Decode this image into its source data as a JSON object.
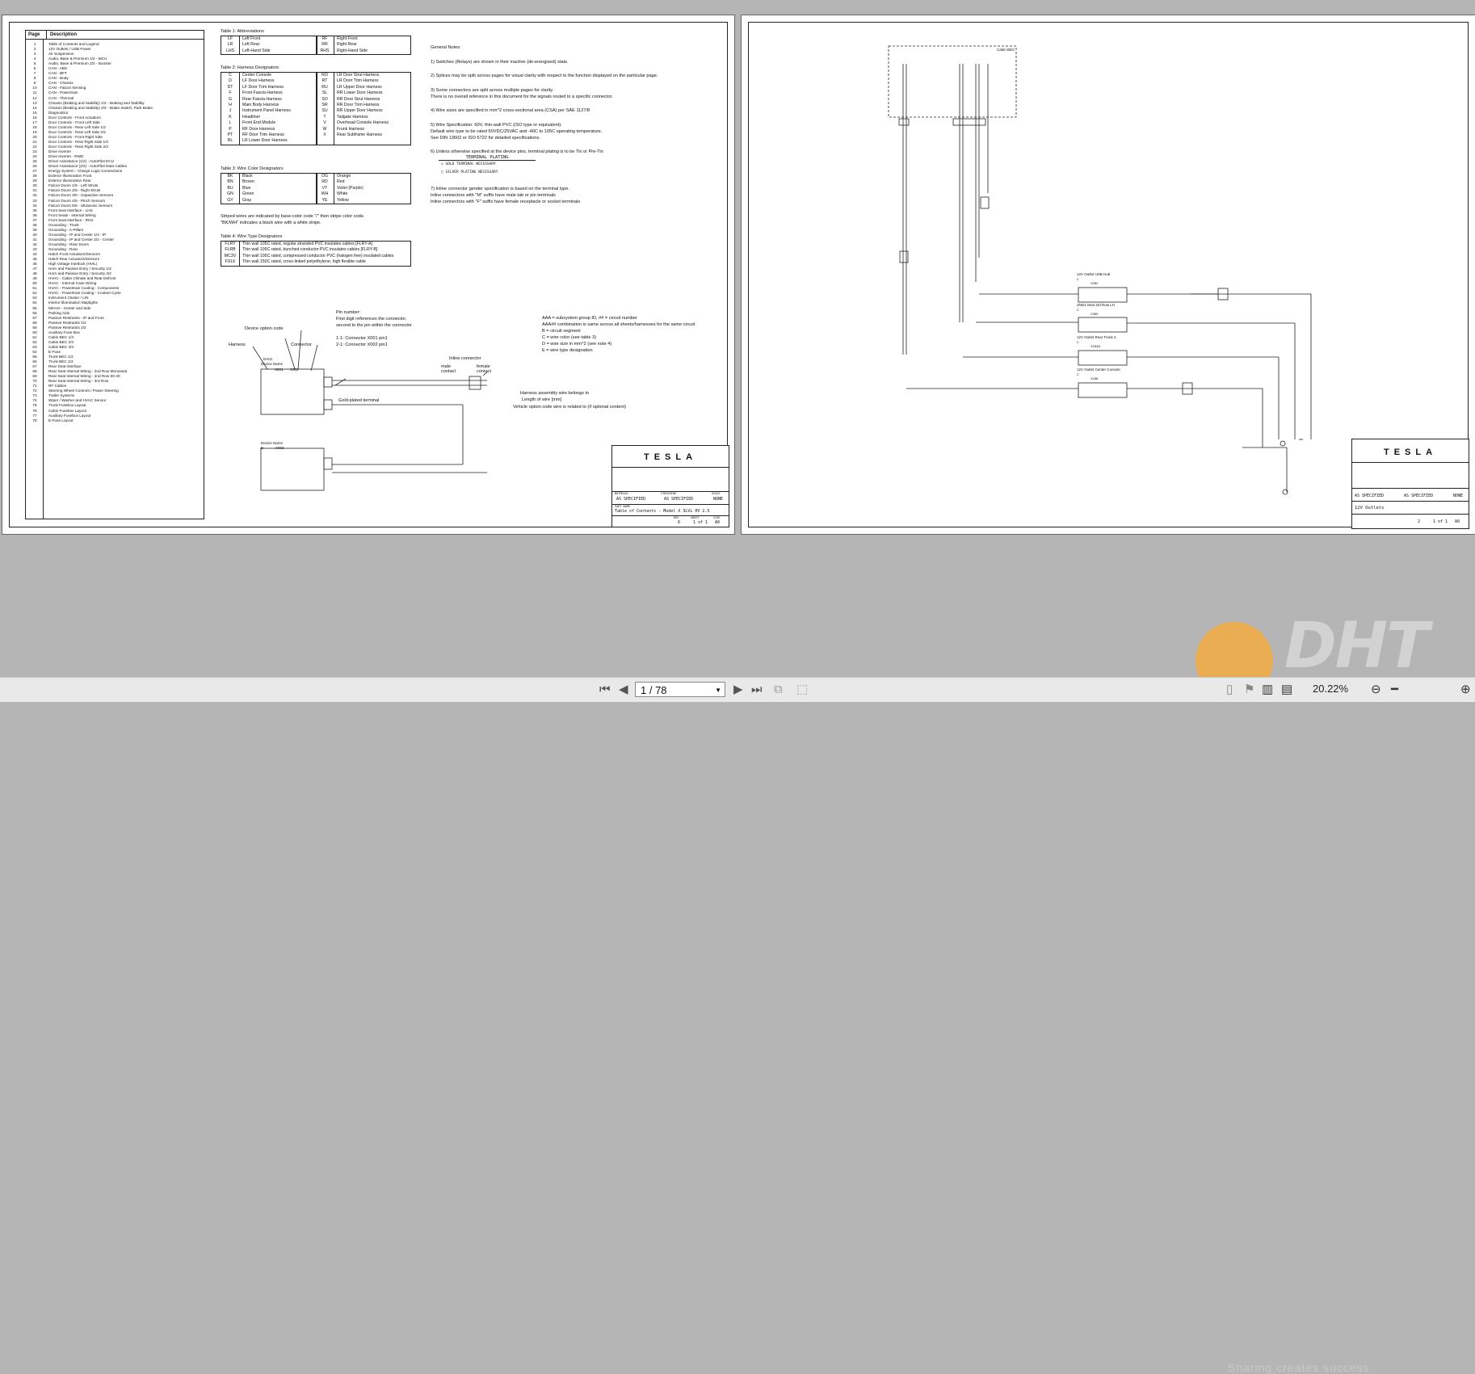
{
  "sheet1": {
    "toc_header": {
      "page": "Page",
      "description": "Description"
    },
    "toc": [
      {
        "p": "1",
        "d": "Table of Contents and Legend"
      },
      {
        "p": "2",
        "d": "12V Outlets / USB Power"
      },
      {
        "p": "3",
        "d": "Air Suspension"
      },
      {
        "p": "4",
        "d": "Audio, Base & Premium 1/2 - MCU"
      },
      {
        "p": "5",
        "d": "Audio, Base & Premium 2/2 - Booster"
      },
      {
        "p": "6",
        "d": "CAN - ABS"
      },
      {
        "p": "7",
        "d": "CAN - BFT"
      },
      {
        "p": "8",
        "d": "CAN - Body"
      },
      {
        "p": "9",
        "d": "CAN - Chassis"
      },
      {
        "p": "10",
        "d": "CAN - Falcon Sensing"
      },
      {
        "p": "11",
        "d": "CAN - Powertrain"
      },
      {
        "p": "12",
        "d": "CAN - Thermal"
      },
      {
        "p": "13",
        "d": "Chassis (Braking and Stability) 1/2 - Braking and Stability"
      },
      {
        "p": "14",
        "d": "Chassis (Braking and Stability) 2/2 - Brake Switch, Park Brake"
      },
      {
        "p": "15",
        "d": "Diagnostics"
      },
      {
        "p": "16",
        "d": "Door Controls - Front Actuators"
      },
      {
        "p": "17",
        "d": "Door Controls - Front Left Side"
      },
      {
        "p": "18",
        "d": "Door Controls - Rear Left Side 1/2"
      },
      {
        "p": "19",
        "d": "Door Controls - Rear Left Side 2/2"
      },
      {
        "p": "20",
        "d": "Door Controls - Front Right Side"
      },
      {
        "p": "21",
        "d": "Door Controls - Rear Right Side 1/2"
      },
      {
        "p": "22",
        "d": "Door Controls - Rear Right Side 2/2"
      },
      {
        "p": "23",
        "d": "Drive Inverter"
      },
      {
        "p": "24",
        "d": "Drive Inverter - RWD"
      },
      {
        "p": "25",
        "d": "Driver Assistance (1/2) - AutoPilot ECU"
      },
      {
        "p": "26",
        "d": "Driver Assistance (2/2) - AutoPilot Data Cables"
      },
      {
        "p": "27",
        "d": "Energy System - Charge Logic Connections"
      },
      {
        "p": "28",
        "d": "Exterior Illumination Front"
      },
      {
        "p": "29",
        "d": "Exterior Illumination Rear"
      },
      {
        "p": "30",
        "d": "Falcon Doors 1/5 - Left Struts"
      },
      {
        "p": "31",
        "d": "Falcon Doors 2/5 - Right Struts"
      },
      {
        "p": "32",
        "d": "Falcon Doors 3/5 - Capacitive Sensors"
      },
      {
        "p": "33",
        "d": "Falcon Doors 4/5 - Pinch Sensors"
      },
      {
        "p": "34",
        "d": "Falcon Doors 5/5 - Ultrasonic Sensors"
      },
      {
        "p": "35",
        "d": "Front Seat Interface - LHS"
      },
      {
        "p": "36",
        "d": "Front Seats - Internal Wiring"
      },
      {
        "p": "37",
        "d": "Front Seat Interface - RHS"
      },
      {
        "p": "38",
        "d": "Grounding - Trunk"
      },
      {
        "p": "39",
        "d": "Grounding - A-Pillars"
      },
      {
        "p": "40",
        "d": "Grounding - IP and Center 1/2 - IP"
      },
      {
        "p": "41",
        "d": "Grounding - IP and Center 2/2 - Center"
      },
      {
        "p": "42",
        "d": "Grounding - Rear Doors"
      },
      {
        "p": "43",
        "d": "Grounding - Rear"
      },
      {
        "p": "44",
        "d": "Hatch Front Actuators/Sensors"
      },
      {
        "p": "45",
        "d": "Hatch Rear Actuators/Sensors"
      },
      {
        "p": "46",
        "d": "High Voltage Interlock (HVIL)"
      },
      {
        "p": "47",
        "d": "Horn and Passive Entry / Security 1/2"
      },
      {
        "p": "48",
        "d": "Horn and Passive Entry / Security 2/2"
      },
      {
        "p": "49",
        "d": "HVAC - Cabin Climate and Rear Defrost"
      },
      {
        "p": "50",
        "d": "HVAC - Internal Case Wiring"
      },
      {
        "p": "51",
        "d": "HVAC - Powertrain Cooling - Components"
      },
      {
        "p": "52",
        "d": "HVAC - Powertrain Cooling - Coolant Cycle"
      },
      {
        "p": "53",
        "d": "Instrument Cluster / LIN"
      },
      {
        "p": "54",
        "d": "Interior Illumination Maplights"
      },
      {
        "p": "55",
        "d": "Mirrors - Center and Side"
      },
      {
        "p": "56",
        "d": "Parking Aids"
      },
      {
        "p": "57",
        "d": "Passive Restraints - IP and Front"
      },
      {
        "p": "58",
        "d": "Passive Restraints 1/2"
      },
      {
        "p": "59",
        "d": "Passive Restraints 2/2"
      },
      {
        "p": "60",
        "d": "Auxiliary Fuse Box"
      },
      {
        "p": "61",
        "d": "Cabin BEC 1/3"
      },
      {
        "p": "62",
        "d": "Cabin BEC 2/3"
      },
      {
        "p": "63",
        "d": "Cabin BEC 3/3"
      },
      {
        "p": "64",
        "d": "E-Fuse"
      },
      {
        "p": "65",
        "d": "Trunk BEC 1/2"
      },
      {
        "p": "66",
        "d": "Trunk BEC 2/2"
      },
      {
        "p": "67",
        "d": "Rear Seat Interface"
      },
      {
        "p": "68",
        "d": "Rear Seat Internal Wiring - 2nd Row Monoseat"
      },
      {
        "p": "69",
        "d": "Rear Seat Internal Wiring - 2nd Row 60-40"
      },
      {
        "p": "70",
        "d": "Rear Seat Internal Wiring - 3rd Row"
      },
      {
        "p": "71",
        "d": "RF Cables"
      },
      {
        "p": "72",
        "d": "Steering Wheel Controls / Power Steering"
      },
      {
        "p": "73",
        "d": "Trailer Systems"
      },
      {
        "p": "74",
        "d": "Wiper / Washer and HVAC Sensor"
      },
      {
        "p": "75",
        "d": "Trunk Fusebox Layout"
      },
      {
        "p": "76",
        "d": "Cabin Fusebox Layout"
      },
      {
        "p": "77",
        "d": "Auxiliary Fusebox Layout"
      },
      {
        "p": "78",
        "d": "E-Fuse Layout"
      }
    ],
    "table1_caption": "Table 1: Abbreviations",
    "table1": [
      {
        "a": "LF",
        "b": "Left Front",
        "c": "RF",
        "d": "Right Front"
      },
      {
        "a": "LR",
        "b": "Left Rear",
        "c": "RR",
        "d": "Right Rear"
      },
      {
        "a": "LHS",
        "b": "Left-Hand Side",
        "c": "RHS",
        "d": "Right-Hand Side"
      }
    ],
    "table2_caption": "Table 2: Harness Designators",
    "table2": [
      {
        "a": "C",
        "b": "Center Console",
        "c": "RO",
        "d": "LR Door Strut Harness"
      },
      {
        "a": "D",
        "b": "LF Door Harness",
        "c": "RT",
        "d": "LR Door Trim Harness"
      },
      {
        "a": "DT",
        "b": "LF Door Trim Harness",
        "c": "RU",
        "d": "LR Upper Door Harness"
      },
      {
        "a": "F",
        "b": "Front Fascia Harness",
        "c": "SL",
        "d": "RR Lower Door Harness"
      },
      {
        "a": "G",
        "b": "Rear Fascia Harness",
        "c": "SO",
        "d": "RR Door Strut Harness"
      },
      {
        "a": "H",
        "b": "Main Body Harness",
        "c": "SR",
        "d": "RR Door Trim Harness"
      },
      {
        "a": "J",
        "b": "Instrument Panel Harness",
        "c": "SU",
        "d": "RR Upper Door Harness"
      },
      {
        "a": "K",
        "b": "Headliner",
        "c": "T",
        "d": "Tailgate Harness"
      },
      {
        "a": "L",
        "b": "Front End Module",
        "c": "V",
        "d": "Overhead Console Harness"
      },
      {
        "a": "P",
        "b": "RF Door Harness",
        "c": "W",
        "d": "Frunk Harness"
      },
      {
        "a": "PT",
        "b": "RF Door Trim Harness",
        "c": "X",
        "d": "Rear Subframe Harness"
      },
      {
        "a": "RL",
        "b": "LR Lower Door Harness",
        "c": "",
        "d": ""
      }
    ],
    "table3_caption": "Table 3: Wire Color Designators",
    "table3": [
      {
        "a": "BK",
        "b": "Black",
        "c": "OG",
        "d": "Orange"
      },
      {
        "a": "BN",
        "b": "Brown",
        "c": "RD",
        "d": "Red"
      },
      {
        "a": "BU",
        "b": "Blue",
        "c": "VT",
        "d": "Violet (Purple)"
      },
      {
        "a": "GN",
        "b": "Green",
        "c": "WH",
        "d": "White"
      },
      {
        "a": "GY",
        "b": "Gray",
        "c": "YE",
        "d": "Yellow"
      }
    ],
    "striped_note_1": "Striped wires are indicated by base-color code \"/\" then stripe color code.",
    "striped_note_2": "\"BK/WH\" indicates a black wire with a white stripe.",
    "table4_caption": "Table 4: Wire Type Designators",
    "table4": [
      {
        "a": "FLRY",
        "b": "Thin wall 105C rated, regular stranded PVC insulates cables [FLRY-A]"
      },
      {
        "a": "FLRB",
        "b": "Thin wall 105C rated, bunched conductor PVC insulates cables [FLRY-B]"
      },
      {
        "a": "MC3V",
        "b": "Thin wall 105C rated, compressed conductor PVC (halogen free) insulated cables"
      },
      {
        "a": "F91X",
        "b": "Thin wall 150C rated, cross-linked polyethylene, high flexible cable"
      }
    ],
    "general_notes_title": "General Notes:",
    "general_notes": [
      "1) Switches (Relays) are shown in their inactive (de-energized) state.",
      "2) Splices may be split across pages for visual clarity with respect to the function displayed on the particular page.",
      "3) Some connectors are split across multiple pages for clarity.",
      "    There is no overall reference in this document for the signals routed to a specific connector.",
      "4) Wire sizes are specified in mm^2 cross-sectional area (CSA) per SAE 1127/8",
      "5) Wire Specification: 60V, thin-wall PVC (ISO type or equivalent).",
      "    Default wire type to be rated 60VDC/25VAC and -40C to 105C operating temperature.",
      "    See DIN 13602 or ISO 6722 for detailed specifications.",
      "6) Unless otherwise specified at the device pins, terminal plating is to be Tin or Pre-Tin"
    ],
    "plating_title": "TERMINAL PLATING",
    "plating_items": [
      "GOLD TERMINAL NECESSARY",
      "SILVER PLATING NECESSARY"
    ],
    "inline_notes": [
      "7) Inline connector gender specification is based on the terminal type.",
      "    Inline connectors with \"M\" suffix have male tab or pin terminals",
      "    Inline connectors with \"F\" suffix have female receptacle or socket terminals"
    ],
    "legend": {
      "device_option_code": "Device option code",
      "harness": "Harness",
      "connector": "Connector",
      "pin_number": "Pin number:",
      "pin_line1": "First digit references the connector,",
      "pin_line2": "second to the pin within the connector",
      "pin_ex1": "1-1: Connector X001 pin1",
      "pin_ex2": "2-1: Connector X002 pin1",
      "inline_connector": "Inline connector",
      "male_contact": "male contact",
      "female_contact": "female contact",
      "gold_plated": "Gold-plated terminal",
      "aaa_1": "AAA = subsystem group ID, ## = circuit number",
      "aaa_2": "AAA## combination is same across all sheets/harnesses for the same circuit",
      "aaa_3": "B = circuit segment",
      "aaa_4": "C = wire color (see table 3)",
      "aaa_5": "D = wire size in mm^2 (see note 4)",
      "aaa_6": "E = wire type designation",
      "harness_assembly": "Harness assembly wire belongs to",
      "length_of_wire": "Length of wire [mm]",
      "vehicle_option_code": "Vehicle option code wire is related to (if optional content)",
      "device_name_1": "Device Name",
      "device_name_2": "Device Name",
      "dev_code": "DA01",
      "conn_x001": "X001",
      "conn_x002": "X002",
      "conn_x003": "X003",
      "dev_b": "B"
    },
    "title_block": {
      "logo": "TESLA",
      "material": "AS SPECIFIED",
      "finishing": "AS SPECIFIED",
      "scale": "NONE",
      "part_name": "Table of Contents - Model X 3LVL HV 2.5",
      "rev": "6",
      "sheet": "1 of 1",
      "size": "A0",
      "labels": {
        "material": "MATERIAL",
        "finishing": "FINISHING",
        "scale": "SCALE",
        "part_name": "PART NAME",
        "part_number": "PART NUMBER",
        "rev": "REV",
        "sheet": "SHEET",
        "size": "SIZE"
      }
    }
  },
  "sheet2": {
    "cabin_bec": "Cabin BEC",
    "outlets": [
      {
        "name": "12V Outlet USB Hub",
        "ref": "C",
        "conn": "X282"
      },
      {
        "name": "2ND1 Seat 3rd Row LH",
        "ref": "C",
        "conn": "X369"
      },
      {
        "name": "12V Outlet Rear Trunk 2",
        "ref": "C",
        "conn": "X184A"
      },
      {
        "name": "12V Outlet Center Console",
        "ref": "C",
        "conn": "X188"
      }
    ],
    "title_block": {
      "logo": "TESLA",
      "material": "AS SPECIFIED",
      "finishing": "AS SPECIFIED",
      "scale": "NONE",
      "part_name": "12V Outlets",
      "rev": "2",
      "sheet": "1 of 1",
      "size": "A0"
    }
  },
  "toolbar": {
    "page_value": "1 / 78",
    "zoom": "20.22%"
  },
  "watermark": {
    "text": "DHT",
    "sub": "Sharing creates success"
  }
}
